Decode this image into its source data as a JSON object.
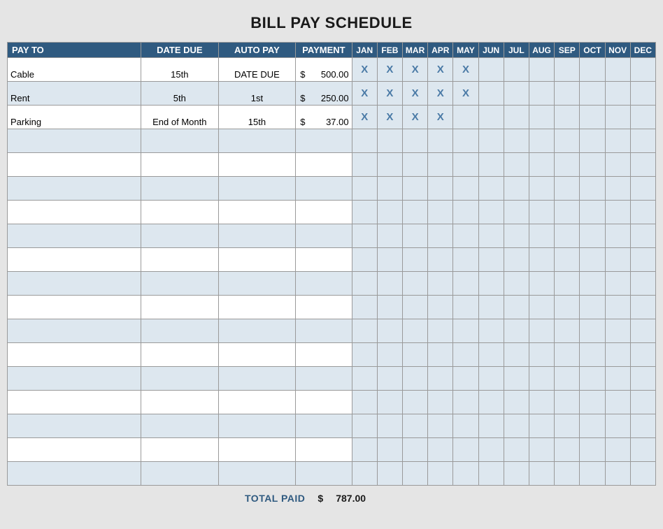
{
  "title": "BILL PAY SCHEDULE",
  "headers": {
    "payto": "PAY TO",
    "datedue": "DATE DUE",
    "autopay": "AUTO PAY",
    "payment": "PAYMENT",
    "months": [
      "JAN",
      "FEB",
      "MAR",
      "APR",
      "MAY",
      "JUN",
      "JUL",
      "AUG",
      "SEP",
      "OCT",
      "NOV",
      "DEC"
    ]
  },
  "currency": "$",
  "rows": [
    {
      "payto": "Cable",
      "datedue": "15th",
      "autopay": "DATE DUE",
      "payment": "500.00",
      "checked": [
        true,
        true,
        true,
        true,
        true,
        false,
        false,
        false,
        false,
        false,
        false,
        false
      ]
    },
    {
      "payto": "Rent",
      "datedue": "5th",
      "autopay": "1st",
      "payment": "250.00",
      "checked": [
        true,
        true,
        true,
        true,
        true,
        false,
        false,
        false,
        false,
        false,
        false,
        false
      ]
    },
    {
      "payto": "Parking",
      "datedue": "End of Month",
      "autopay": "15th",
      "payment": "37.00",
      "checked": [
        true,
        true,
        true,
        true,
        false,
        false,
        false,
        false,
        false,
        false,
        false,
        false
      ]
    },
    {
      "payto": "",
      "datedue": "",
      "autopay": "",
      "payment": "",
      "checked": [
        false,
        false,
        false,
        false,
        false,
        false,
        false,
        false,
        false,
        false,
        false,
        false
      ]
    },
    {
      "payto": "",
      "datedue": "",
      "autopay": "",
      "payment": "",
      "checked": [
        false,
        false,
        false,
        false,
        false,
        false,
        false,
        false,
        false,
        false,
        false,
        false
      ]
    },
    {
      "payto": "",
      "datedue": "",
      "autopay": "",
      "payment": "",
      "checked": [
        false,
        false,
        false,
        false,
        false,
        false,
        false,
        false,
        false,
        false,
        false,
        false
      ]
    },
    {
      "payto": "",
      "datedue": "",
      "autopay": "",
      "payment": "",
      "checked": [
        false,
        false,
        false,
        false,
        false,
        false,
        false,
        false,
        false,
        false,
        false,
        false
      ]
    },
    {
      "payto": "",
      "datedue": "",
      "autopay": "",
      "payment": "",
      "checked": [
        false,
        false,
        false,
        false,
        false,
        false,
        false,
        false,
        false,
        false,
        false,
        false
      ]
    },
    {
      "payto": "",
      "datedue": "",
      "autopay": "",
      "payment": "",
      "checked": [
        false,
        false,
        false,
        false,
        false,
        false,
        false,
        false,
        false,
        false,
        false,
        false
      ]
    },
    {
      "payto": "",
      "datedue": "",
      "autopay": "",
      "payment": "",
      "checked": [
        false,
        false,
        false,
        false,
        false,
        false,
        false,
        false,
        false,
        false,
        false,
        false
      ]
    },
    {
      "payto": "",
      "datedue": "",
      "autopay": "",
      "payment": "",
      "checked": [
        false,
        false,
        false,
        false,
        false,
        false,
        false,
        false,
        false,
        false,
        false,
        false
      ]
    },
    {
      "payto": "",
      "datedue": "",
      "autopay": "",
      "payment": "",
      "checked": [
        false,
        false,
        false,
        false,
        false,
        false,
        false,
        false,
        false,
        false,
        false,
        false
      ]
    },
    {
      "payto": "",
      "datedue": "",
      "autopay": "",
      "payment": "",
      "checked": [
        false,
        false,
        false,
        false,
        false,
        false,
        false,
        false,
        false,
        false,
        false,
        false
      ]
    },
    {
      "payto": "",
      "datedue": "",
      "autopay": "",
      "payment": "",
      "checked": [
        false,
        false,
        false,
        false,
        false,
        false,
        false,
        false,
        false,
        false,
        false,
        false
      ]
    },
    {
      "payto": "",
      "datedue": "",
      "autopay": "",
      "payment": "",
      "checked": [
        false,
        false,
        false,
        false,
        false,
        false,
        false,
        false,
        false,
        false,
        false,
        false
      ]
    },
    {
      "payto": "",
      "datedue": "",
      "autopay": "",
      "payment": "",
      "checked": [
        false,
        false,
        false,
        false,
        false,
        false,
        false,
        false,
        false,
        false,
        false,
        false
      ]
    },
    {
      "payto": "",
      "datedue": "",
      "autopay": "",
      "payment": "",
      "checked": [
        false,
        false,
        false,
        false,
        false,
        false,
        false,
        false,
        false,
        false,
        false,
        false
      ]
    },
    {
      "payto": "",
      "datedue": "",
      "autopay": "",
      "payment": "",
      "checked": [
        false,
        false,
        false,
        false,
        false,
        false,
        false,
        false,
        false,
        false,
        false,
        false
      ]
    }
  ],
  "footer": {
    "label": "TOTAL PAID",
    "currency": "$",
    "total_paid": "787.00"
  },
  "check_mark": "X"
}
